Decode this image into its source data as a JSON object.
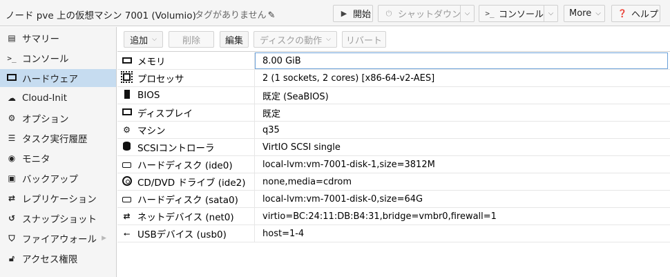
{
  "header": {
    "title": "ノード pve 上の仮想マシン 7001 (Volumio)",
    "tags": "タグがありません",
    "buttons": {
      "start": "開始",
      "shutdown": "シャットダウン",
      "console": "コンソール",
      "more": "More",
      "help": "ヘルプ"
    }
  },
  "sidebar": {
    "items": [
      {
        "label": "サマリー",
        "icon": "book-icon"
      },
      {
        "label": "コンソール",
        "icon": "terminal-icon"
      },
      {
        "label": "ハードウェア",
        "icon": "desktop-icon"
      },
      {
        "label": "Cloud-Init",
        "icon": "cloud-icon"
      },
      {
        "label": "オプション",
        "icon": "gear-icon"
      },
      {
        "label": "タスク実行履歴",
        "icon": "list-icon"
      },
      {
        "label": "モニタ",
        "icon": "eye-icon"
      },
      {
        "label": "バックアップ",
        "icon": "floppy-icon"
      },
      {
        "label": "レプリケーション",
        "icon": "retweet-icon"
      },
      {
        "label": "スナップショット",
        "icon": "history-icon"
      },
      {
        "label": "ファイアウォール",
        "icon": "shield-icon"
      },
      {
        "label": "アクセス権限",
        "icon": "unlock-icon"
      }
    ],
    "active_index": 2
  },
  "toolbar": {
    "add": "追加",
    "remove": "削除",
    "edit": "編集",
    "disk_action": "ディスクの動作",
    "revert": "リバート"
  },
  "hardware": [
    {
      "key": "メモリ",
      "value": "8.00 GiB",
      "icon": "memory-icon"
    },
    {
      "key": "プロセッサ",
      "value": "2 (1 sockets, 2 cores) [x86-64-v2-AES]",
      "icon": "cpu-icon"
    },
    {
      "key": "BIOS",
      "value": "既定 (SeaBIOS)",
      "icon": "microchip-icon"
    },
    {
      "key": "ディスプレイ",
      "value": "既定",
      "icon": "monitor-icon"
    },
    {
      "key": "マシン",
      "value": "q35",
      "icon": "cogs-icon"
    },
    {
      "key": "SCSIコントローラ",
      "value": "VirtIO SCSI single",
      "icon": "database-icon"
    },
    {
      "key": "ハードディスク (ide0)",
      "value": "local-lvm:vm-7001-disk-1,size=3812M",
      "icon": "hdd-icon"
    },
    {
      "key": "CD/DVD ドライブ (ide2)",
      "value": "none,media=cdrom",
      "icon": "cdrom-icon"
    },
    {
      "key": "ハードディスク (sata0)",
      "value": "local-lvm:vm-7001-disk-0,size=64G",
      "icon": "hdd-icon"
    },
    {
      "key": "ネットデバイス (net0)",
      "value": "virtio=BC:24:11:DB:B4:31,bridge=vmbr0,firewall=1",
      "icon": "exchange-icon"
    },
    {
      "key": "USBデバイス (usb0)",
      "value": "host=1-4",
      "icon": "usb-icon"
    }
  ],
  "colors": {
    "active_nav": "#c6dcf0",
    "selected_border": "#6aa0d8"
  }
}
